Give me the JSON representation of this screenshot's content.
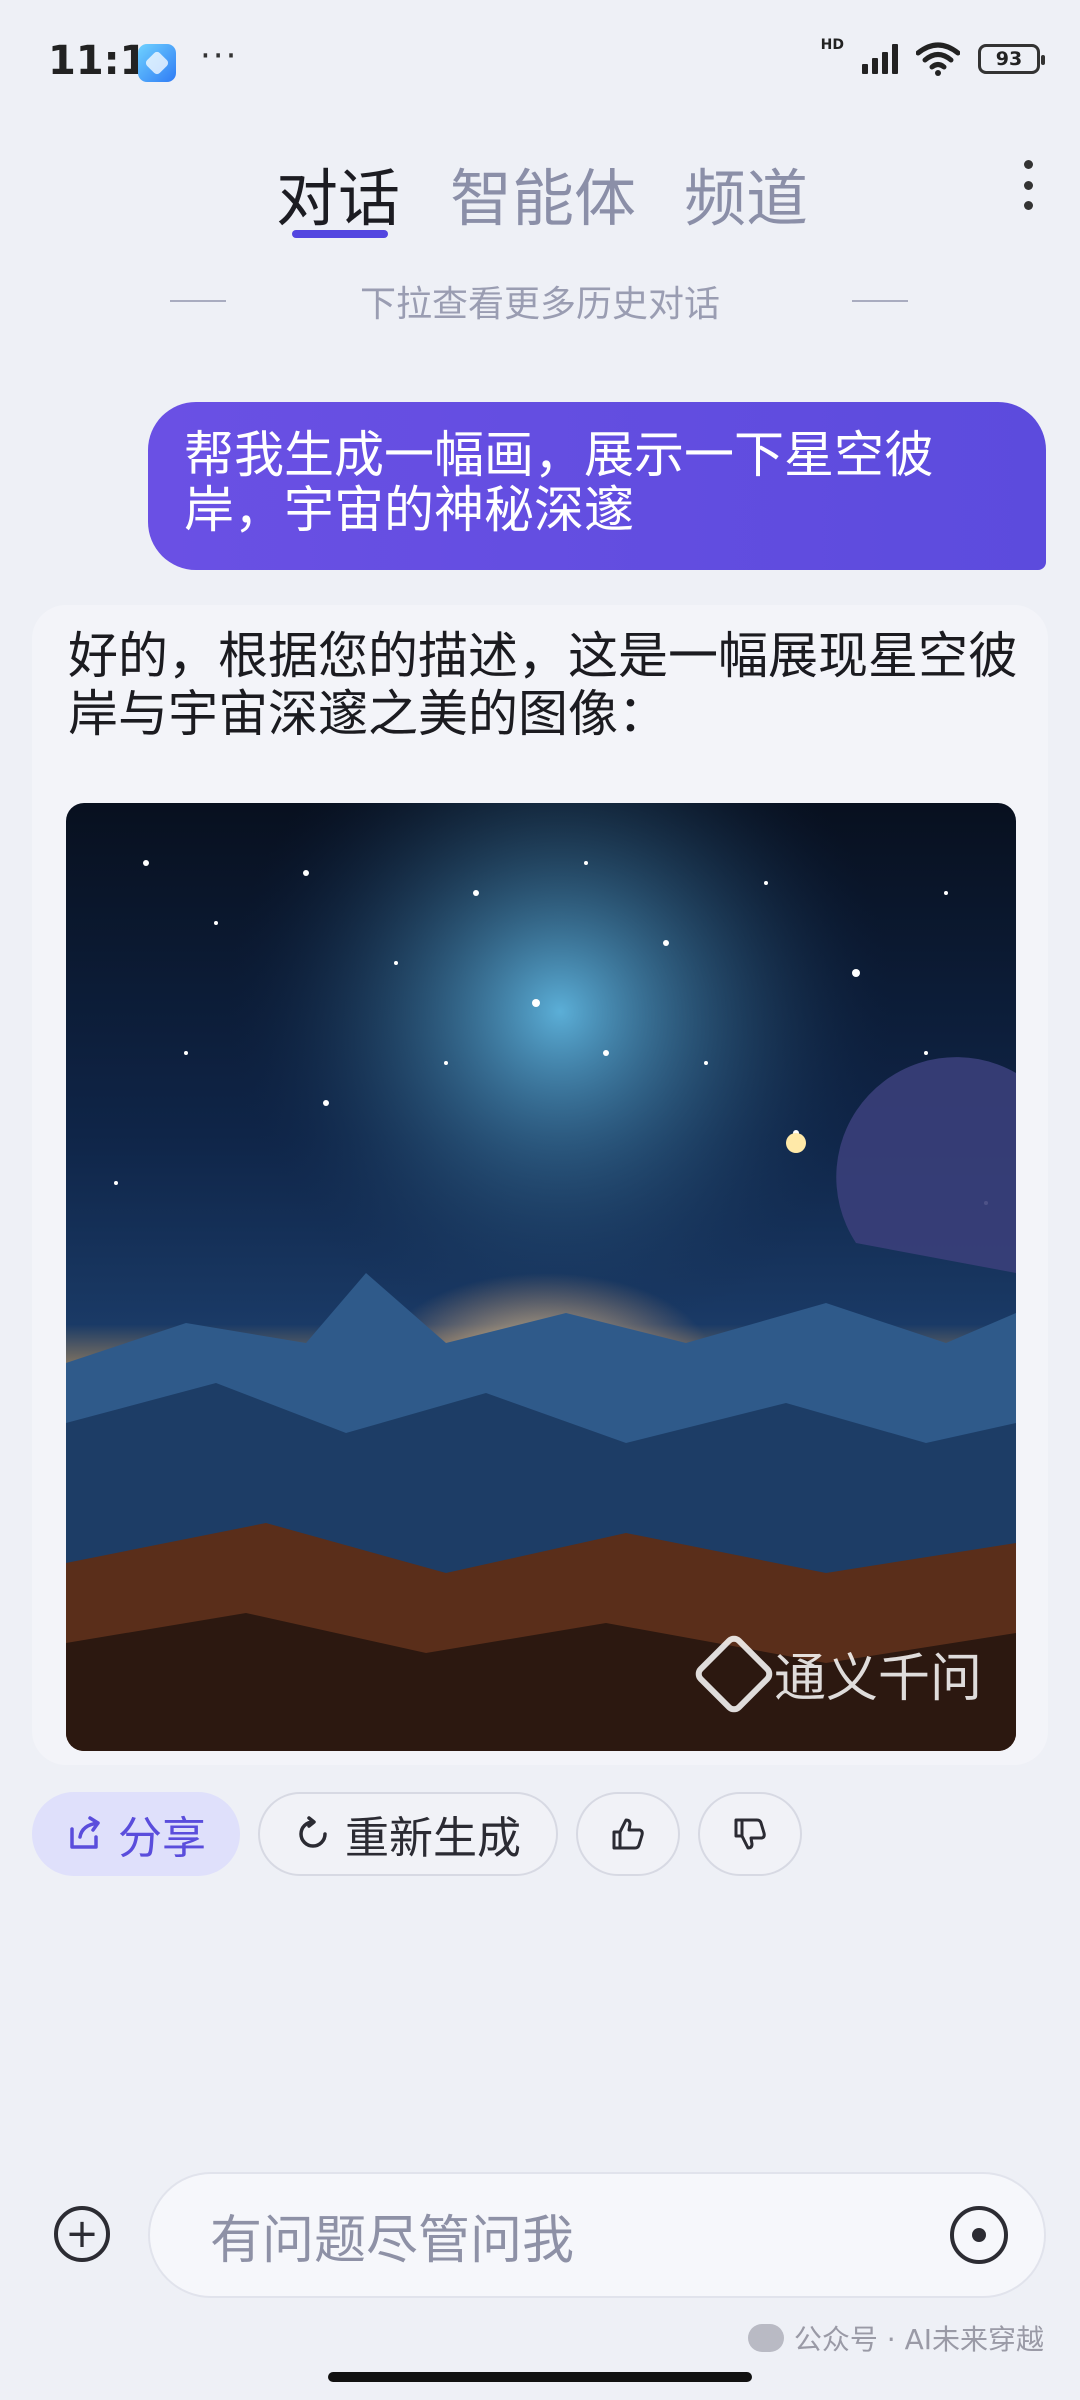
{
  "status_bar": {
    "time": "11:10",
    "more_dots": "···",
    "network": "HD",
    "battery": "93"
  },
  "tabs": [
    {
      "label": "对话",
      "active": true
    },
    {
      "label": "智能体",
      "active": false
    },
    {
      "label": "频道",
      "active": false
    }
  ],
  "history_hint": "下拉查看更多历史对话",
  "messages": {
    "user": "帮我生成一幅画，展示一下星空彼岸，宇宙的神秘深邃",
    "bot": "好的，根据您的描述，这是一幅展现星空彼岸与宇宙深邃之美的图像：",
    "image_watermark": "通义千问"
  },
  "actions": {
    "share": "分享",
    "regenerate": "重新生成",
    "like_icon": "thumbs-up-icon",
    "dislike_icon": "thumbs-down-icon"
  },
  "input": {
    "placeholder": "有问题尽管问我"
  },
  "footer_watermark": "公众号 · AI未来穿越",
  "colors": {
    "accent": "#5346e0",
    "user_bubble": "#6a50e4",
    "background": "#eef0f6"
  }
}
